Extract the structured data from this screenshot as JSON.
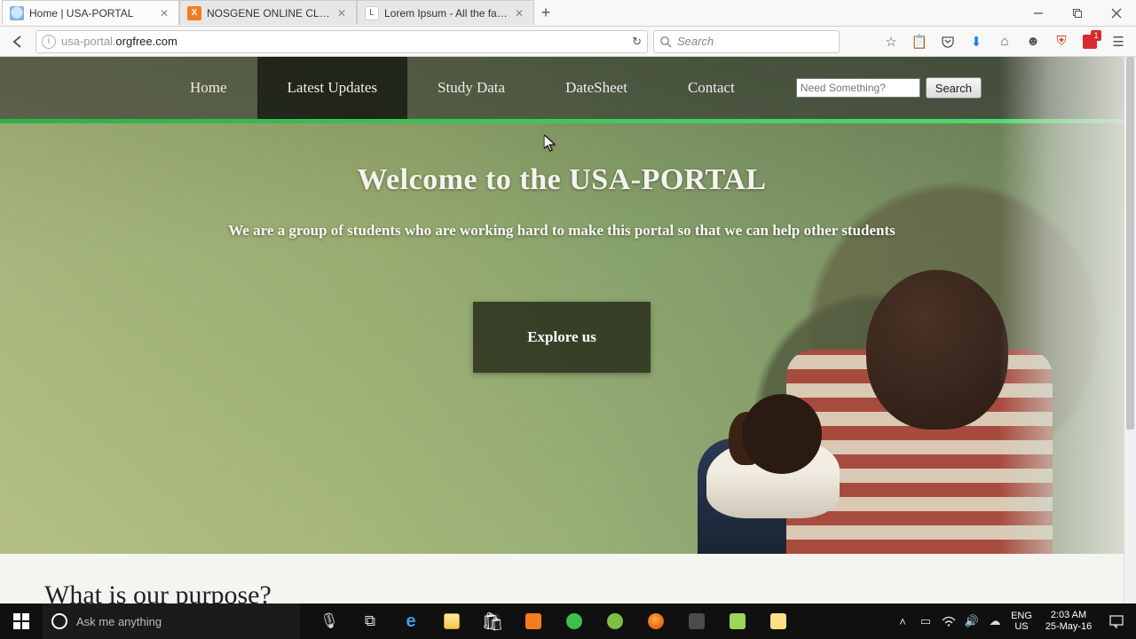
{
  "browser": {
    "tabs": [
      {
        "title": "Home | USA-PORTAL",
        "favicon": "globe"
      },
      {
        "title": "NOSGENE ONLINE CLASS",
        "favicon": "xampp"
      },
      {
        "title": "Lorem Ipsum - All the fact...",
        "favicon": "li"
      }
    ],
    "url_plain": "usa-portal.",
    "url_host": "orgfree.com",
    "search_placeholder": "Search",
    "badge_count": "1"
  },
  "page": {
    "nav": {
      "items": [
        "Home",
        "Latest Updates",
        "Study Data",
        "DateSheet",
        "Contact"
      ],
      "active_index": 1,
      "search_placeholder": "Need Something?",
      "search_button": "Search"
    },
    "hero": {
      "title": "Welcome to the USA-PORTAL",
      "subtitle": "We are a group of students who are working hard to make this portal so that we can help other students",
      "cta": "Explore us"
    },
    "section_heading": "What is our purpose?"
  },
  "taskbar": {
    "cortana_placeholder": "Ask me anything",
    "lang_top": "ENG",
    "lang_bottom": "US",
    "time": "2:03 AM",
    "date": "25-May-16"
  }
}
